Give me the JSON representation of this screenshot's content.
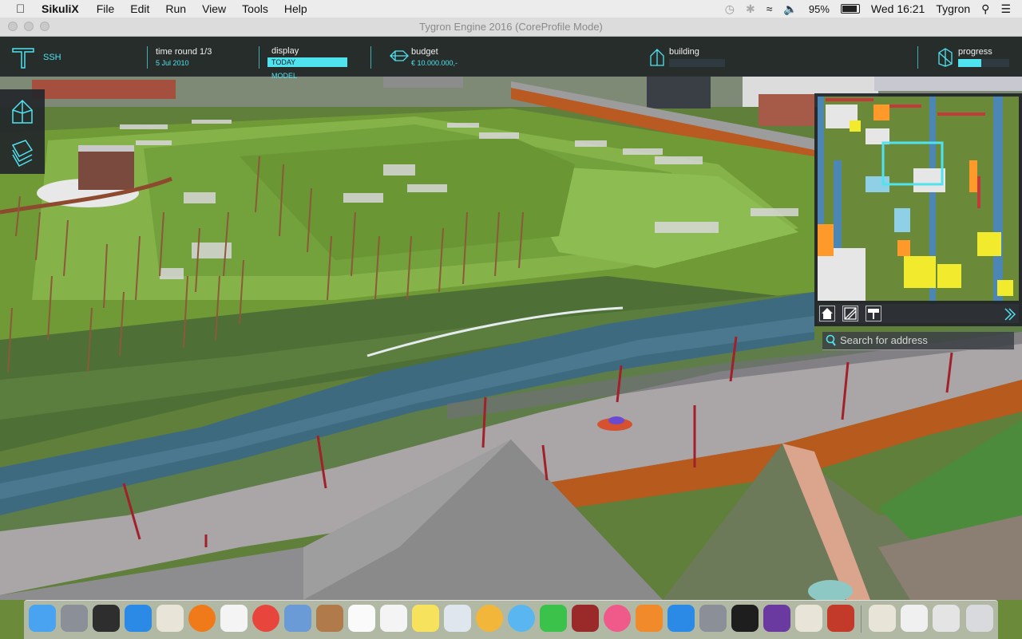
{
  "menubar": {
    "app_name": "SikuliX",
    "items": [
      "File",
      "Edit",
      "Run",
      "View",
      "Tools",
      "Help"
    ],
    "battery": "95%",
    "clock": "Wed 16:21",
    "user": "Tygron"
  },
  "window": {
    "title": "Tygron Engine 2016 (CoreProfile Mode)"
  },
  "hud": {
    "project": "SSH",
    "time_label": "time round 1/3",
    "time_date": "5 Jul 2010",
    "display_label": "display",
    "display_today": "TODAY",
    "display_model": "MODEL",
    "budget_label": "budget",
    "budget_value": "€ 10.000.000,-",
    "building_label": "building",
    "progress_label": "progress",
    "progress_fraction": 0.45
  },
  "minimap": {
    "search_placeholder": "Search for address"
  },
  "colors": {
    "accent": "#4fe3f0",
    "hud_bg": "#23262a"
  }
}
